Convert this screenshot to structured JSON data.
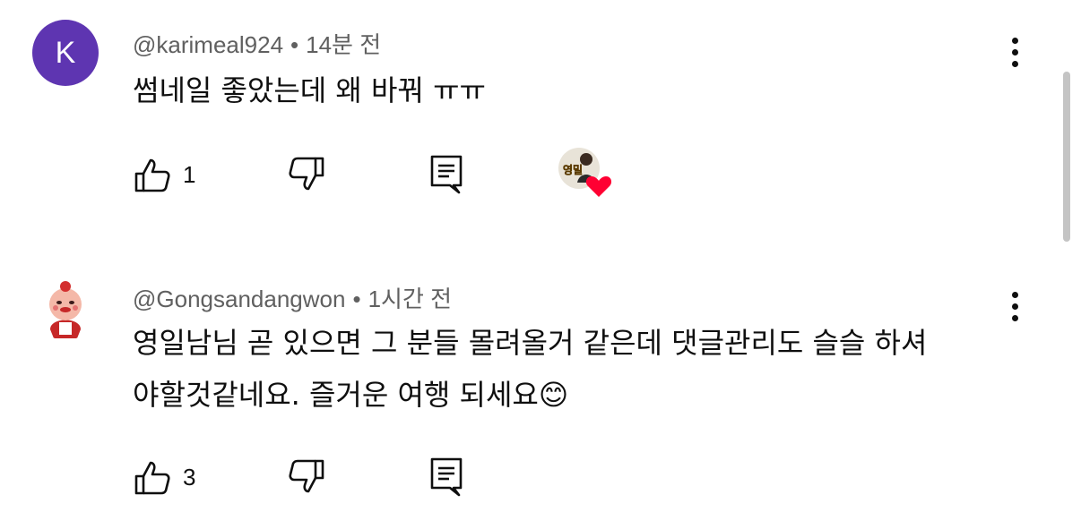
{
  "comments": [
    {
      "avatar_letter": "K",
      "author": "@karimeal924",
      "time": "14분 전",
      "text": "썸네일 좋았는데 왜 바꿔 ㅠㅠ",
      "likes": "1",
      "creator_heart_badge": "영밀",
      "avatar_color": "#5e35b1"
    },
    {
      "author": "@Gongsandangwon",
      "time": "1시간 전",
      "text_line1": "영일남님 곧 있으면 그 분들 몰려올거 같은데 댓글관리도 슬슬 하셔",
      "text_line2": "야할것같네요. 즐거운 여행 되세요",
      "emoji": "😊",
      "likes": "3"
    }
  ],
  "icons": {
    "like": "thumbs-up-icon",
    "dislike": "thumbs-down-icon",
    "reply": "reply-icon",
    "more": "more-vertical-icon"
  },
  "separator": "•"
}
